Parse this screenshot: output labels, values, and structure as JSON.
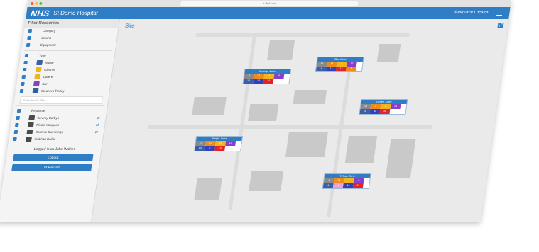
{
  "browser": {
    "url": "ir.abyl.com"
  },
  "header": {
    "logo": "NHS",
    "hospital": "St Demo Hospital",
    "app_name": "Resource Locator"
  },
  "sidebar": {
    "title": "Filter Resources",
    "categories": [
      "Category",
      "Learns",
      "Equipment"
    ],
    "type_header": "Type",
    "types": [
      {
        "label": "Nurse",
        "color": "#3a5ea8"
      },
      {
        "label": "Cleaner",
        "color": "#f0b51a"
      },
      {
        "label": "Caterer",
        "color": "#f0b51a"
      },
      {
        "label": "Bar",
        "color": "#8a3fc7"
      },
      {
        "label": "Cleaners Trolley",
        "color": "#2f5fa0"
      }
    ],
    "search_placeholder": "Enter text to filter...",
    "resource_header": "Resource",
    "resources": [
      "Jeremy Corbyn",
      "Nicola Sturgeon",
      "Dominic Cummings",
      "Siobhan Baillie"
    ],
    "logged_in": "Logged in as John Walker",
    "logout": "Logout",
    "reload": "Reload"
  },
  "map": {
    "title": "Site",
    "zones": [
      {
        "name": "Orange Zone",
        "values": [
          "4",
          "3",
          "4",
          "9",
          "14",
          "10",
          "14"
        ]
      },
      {
        "name": "Blue Zone",
        "values": [
          "14",
          "14",
          "6",
          "12",
          "4",
          "14",
          "13",
          "1"
        ]
      },
      {
        "name": "Green Zone",
        "values": [
          "14",
          "2",
          "2",
          "13",
          "4",
          "6",
          "10"
        ]
      },
      {
        "name": "Purple Zone",
        "values": [
          "14",
          "14",
          "14",
          "14",
          "14",
          "7",
          "14"
        ]
      },
      {
        "name": "Yellow Zone",
        "values": [
          "4",
          "14",
          "1",
          "8",
          "4",
          "4",
          "14",
          "19"
        ]
      }
    ]
  },
  "colors": {
    "accent": "#2f7ec5",
    "nurse": "#3a5ea8",
    "cleaner": "#f0b51a",
    "bar": "#8a3fc7",
    "alert": "#e0242c"
  }
}
